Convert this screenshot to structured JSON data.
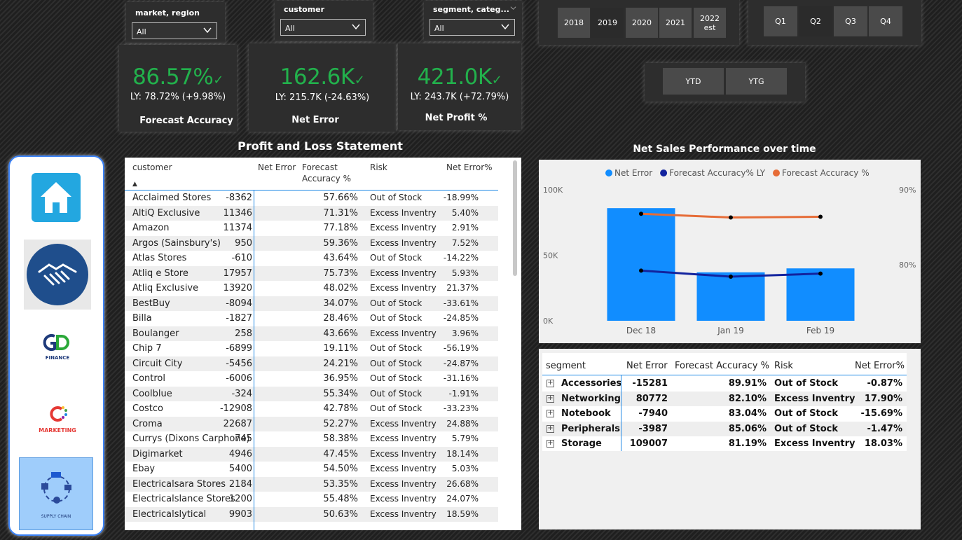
{
  "filters": [
    {
      "label": "market, region",
      "value": "All"
    },
    {
      "label": "customer",
      "value": "All"
    },
    {
      "label": "segment, categ...",
      "value": "All"
    }
  ],
  "years": [
    "2018",
    "2019",
    "2020",
    "2021",
    "2022",
    "est"
  ],
  "quarters": [
    "Q1",
    "Q2",
    "Q3",
    "Q4"
  ],
  "periods": [
    "YTD",
    "YTG"
  ],
  "kpis": [
    {
      "value": "86.57%",
      "ly": "LY: 78.72% (+9.98%)",
      "name": "Forecast Accuracy"
    },
    {
      "value": "162.6K",
      "ly": "LY: 215.7K (-24.63%)",
      "name": "Net Error"
    },
    {
      "value": "421.0K",
      "ly": "LY: 243.7K (+72.79%)",
      "name": "Net Profit %"
    }
  ],
  "pl": {
    "title": "Profit and Loss Statement",
    "headers": {
      "customer": "customer",
      "net_error": "Net Error",
      "fa1": "Forecast",
      "fa2": "Accuracy %",
      "risk": "Risk",
      "nep": "Net Error%"
    },
    "rows": [
      [
        "Acclaimed Stores",
        "-8362",
        "57.66%",
        "Out of Stock",
        "-18.99%"
      ],
      [
        "AltiQ Exclusive",
        "11346",
        "71.31%",
        "Excess Inventry",
        "5.40%"
      ],
      [
        "Amazon",
        "11374",
        "77.18%",
        "Excess Inventry",
        "2.91%"
      ],
      [
        "Argos (Sainsbury's)",
        "950",
        "59.36%",
        "Excess Inventry",
        "7.52%"
      ],
      [
        "Atlas Stores",
        "-610",
        "43.64%",
        "Out of Stock",
        "-14.22%"
      ],
      [
        "Atliq e Store",
        "17957",
        "75.73%",
        "Excess Inventry",
        "5.93%"
      ],
      [
        "Atliq Exclusive",
        "13920",
        "48.02%",
        "Excess Inventry",
        "21.37%"
      ],
      [
        "BestBuy",
        "-8094",
        "34.07%",
        "Out of Stock",
        "-33.61%"
      ],
      [
        "Billa",
        "-1827",
        "28.46%",
        "Out of Stock",
        "-24.85%"
      ],
      [
        "Boulanger",
        "258",
        "43.66%",
        "Excess Inventry",
        "3.96%"
      ],
      [
        "Chip 7",
        "-6899",
        "19.11%",
        "Out of Stock",
        "-56.19%"
      ],
      [
        "Circuit City",
        "-5456",
        "24.21%",
        "Out of Stock",
        "-24.87%"
      ],
      [
        "Control",
        "-6006",
        "36.95%",
        "Out of Stock",
        "-31.16%"
      ],
      [
        "Coolblue",
        "-324",
        "55.34%",
        "Out of Stock",
        "-1.91%"
      ],
      [
        "Costco",
        "-12908",
        "42.78%",
        "Out of Stock",
        "-33.23%"
      ],
      [
        "Croma",
        "22687",
        "52.27%",
        "Excess Inventry",
        "24.88%"
      ],
      [
        "Currys (Dixons Carphone)",
        "745",
        "58.38%",
        "Excess Inventry",
        "5.79%"
      ],
      [
        "Digimarket",
        "4946",
        "47.45%",
        "Excess Inventry",
        "18.14%"
      ],
      [
        "Ebay",
        "5400",
        "54.50%",
        "Excess Inventry",
        "5.03%"
      ],
      [
        "Electricalsara Stores",
        "2184",
        "53.35%",
        "Excess Inventry",
        "26.68%"
      ],
      [
        "Electricalslance Stores",
        "1200",
        "55.48%",
        "Excess Inventry",
        "24.07%"
      ],
      [
        "Electricalslytical",
        "9903",
        "50.63%",
        "Excess Inventry",
        "18.59%"
      ]
    ]
  },
  "chart_data": {
    "type": "bar",
    "title": "Net Sales Performance over time",
    "categories": [
      "Dec 18",
      "Jan 19",
      "Feb 19"
    ],
    "series": [
      {
        "name": "Net Error",
        "type": "bar",
        "axis": "left",
        "color": "#118dff",
        "values": [
          86000,
          37000,
          40000
        ]
      },
      {
        "name": "Forecast Accuracy% LY",
        "type": "line",
        "axis": "right",
        "color": "#12239e",
        "values": [
          79.2,
          78.4,
          78.8
        ]
      },
      {
        "name": "Forecast Accuracy %",
        "type": "line",
        "axis": "right",
        "color": "#e66c37",
        "values": [
          86.8,
          86.3,
          86.4
        ]
      }
    ],
    "left_ticks": [
      "100K",
      "50K",
      "0K"
    ],
    "right_ticks": [
      "90%",
      "80%"
    ],
    "ylim_left": [
      0,
      100000
    ],
    "ylim_right": [
      72.5,
      90
    ]
  },
  "segment": {
    "headers": {
      "segment": "segment",
      "net_error": "Net Error",
      "fa": "Forecast Accuracy %",
      "risk": "Risk",
      "nep": "Net Error%"
    },
    "rows": [
      [
        "Accessories",
        "-15281",
        "89.91%",
        "Out of Stock",
        "-0.87%"
      ],
      [
        "Networking",
        "80772",
        "82.10%",
        "Excess Inventry",
        "17.90%"
      ],
      [
        "Notebook",
        "-7940",
        "83.04%",
        "Out of Stock",
        "-15.69%"
      ],
      [
        "Peripherals",
        "-3987",
        "85.06%",
        "Out of Stock",
        "-1.47%"
      ],
      [
        "Storage",
        "109007",
        "81.19%",
        "Excess Inventry",
        "18.03%"
      ]
    ]
  },
  "nav": {
    "finance_label": "FINANCE",
    "marketing_label": "MARKETING",
    "supply_chain_label": "SUPPLY CHAIN"
  }
}
